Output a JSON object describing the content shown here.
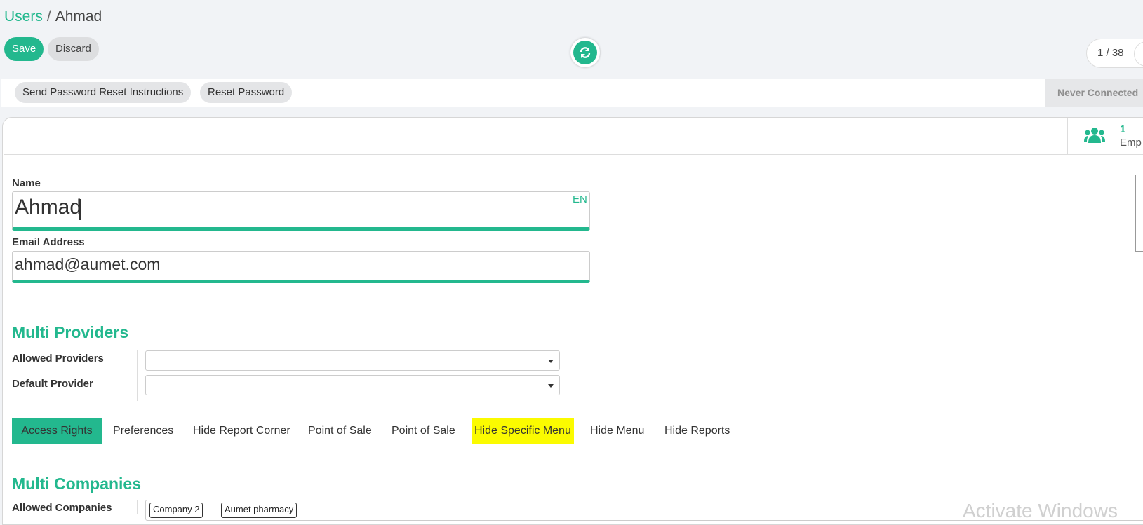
{
  "breadcrumb": {
    "parent": "Users",
    "separator": "/",
    "current": "Ahmad"
  },
  "control_panel": {
    "save_label": "Save",
    "discard_label": "Discard",
    "sync_icon": "refresh-icon",
    "pager": "1 / 38"
  },
  "action_bar": {
    "send_reset_label": "Send Password Reset Instructions",
    "reset_password_label": "Reset Password",
    "status_label": "Never Connected"
  },
  "smart_button": {
    "icon": "users-icon",
    "count": "1",
    "label": "Emp"
  },
  "form": {
    "name_label": "Name",
    "name_value": "Ahmad",
    "lang_badge": "EN",
    "email_label": "Email Address",
    "email_value": "ahmad@aumet.com"
  },
  "multi_providers": {
    "title": "Multi Providers",
    "allowed_label": "Allowed Providers",
    "allowed_value": "",
    "default_label": "Default Provider",
    "default_value": ""
  },
  "tabs": [
    {
      "label": "Access Rights",
      "active": true
    },
    {
      "label": "Preferences"
    },
    {
      "label": "Hide Report Corner"
    },
    {
      "label": "Point of Sale"
    },
    {
      "label": "Point of Sale"
    },
    {
      "label": "Hide Specific Menu",
      "highlighted": true
    },
    {
      "label": "Hide Menu"
    },
    {
      "label": "Hide Reports"
    }
  ],
  "multi_companies": {
    "title": "Multi Companies",
    "allowed_label": "Allowed Companies",
    "tags": [
      "Company 2",
      "Aumet pharmacy"
    ]
  },
  "watermark": "Activate Windows",
  "colors": {
    "accent": "#23b88e",
    "highlight": "#fbfb00",
    "background": "#f1f3f6"
  }
}
